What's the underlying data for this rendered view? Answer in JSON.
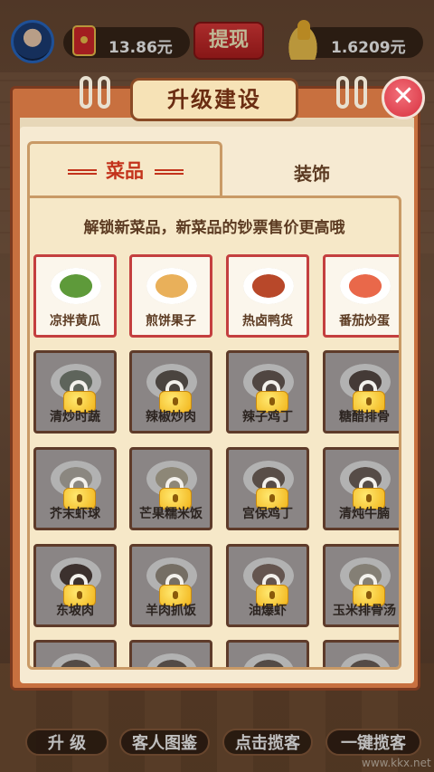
{
  "hud": {
    "money": "13.86元",
    "withdraw_label": "提现",
    "coins": "1.6209元",
    "icons": [
      "avatar",
      "red-packet-icon",
      "thumbs-up-icon"
    ]
  },
  "modal": {
    "title": "升级建设",
    "close_icon": "close-icon",
    "tabs": [
      {
        "label": "菜品",
        "active": true
      },
      {
        "label": "装饰",
        "active": false
      }
    ],
    "subtitle": "解锁新菜品，新菜品的钞票售价更高哦",
    "dishes": [
      {
        "name": "凉拌黄瓜",
        "locked": false,
        "color": "#5e9a3a"
      },
      {
        "name": "煎饼果子",
        "locked": false,
        "color": "#e9b05a"
      },
      {
        "name": "热卤鸭货",
        "locked": false,
        "color": "#b8482a"
      },
      {
        "name": "番茄炒蛋",
        "locked": false,
        "color": "#e9684a"
      },
      {
        "name": "清炒时蔬",
        "locked": true,
        "color": "#6e9a58"
      },
      {
        "name": "辣椒炒肉",
        "locked": true,
        "color": "#8b5a3a"
      },
      {
        "name": "辣子鸡丁",
        "locked": true,
        "color": "#a35a36"
      },
      {
        "name": "糖醋排骨",
        "locked": true,
        "color": "#8b4a2e"
      },
      {
        "name": "芥末虾球",
        "locked": true,
        "color": "#d9c08a"
      },
      {
        "name": "芒果糯米饭",
        "locked": true,
        "color": "#e8c24a"
      },
      {
        "name": "宫保鸡丁",
        "locked": true,
        "color": "#b0643a"
      },
      {
        "name": "清炖牛腩",
        "locked": true,
        "color": "#a8643a"
      },
      {
        "name": "东坡肉",
        "locked": true,
        "color": "#8a3a22"
      },
      {
        "name": "羊肉抓饭",
        "locked": true,
        "color": "#c99a52"
      },
      {
        "name": "油爆虾",
        "locked": true,
        "color": "#d46a3e"
      },
      {
        "name": "玉米排骨汤",
        "locked": true,
        "color": "#d6b46a"
      },
      {
        "name": "",
        "locked": true,
        "color": "#a0643a"
      },
      {
        "name": "",
        "locked": true,
        "color": "#a0643a"
      },
      {
        "name": "",
        "locked": true,
        "color": "#a0643a"
      },
      {
        "name": "",
        "locked": true,
        "color": "#a0643a"
      }
    ]
  },
  "bottom_bar": {
    "upgrade_label": "升 级",
    "guest_book_label": "客人图鉴",
    "attract_label": "点击揽客",
    "auto_attract_label": "一键揽客"
  },
  "watermark": "www.kkx.net"
}
